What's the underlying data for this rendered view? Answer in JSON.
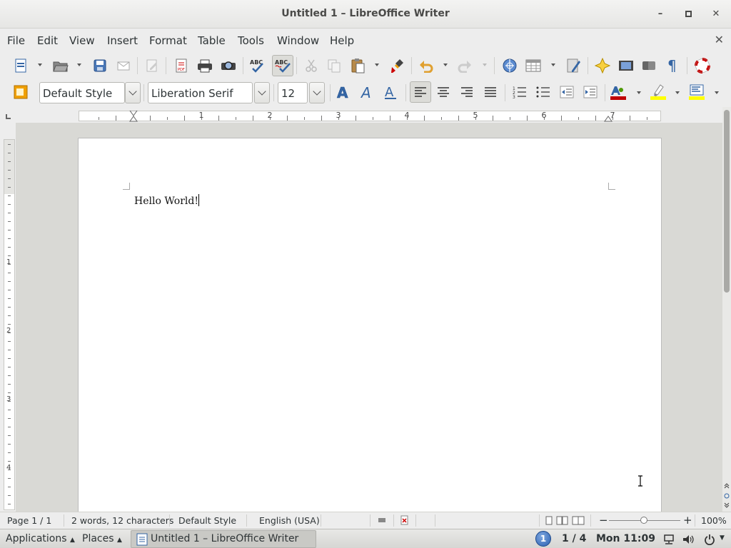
{
  "window": {
    "title": "Untitled 1 – LibreOffice Writer",
    "minimize": "–",
    "maximize": "□",
    "close": "✕"
  },
  "menu": {
    "items": [
      "File",
      "Edit",
      "View",
      "Insert",
      "Format",
      "Table",
      "Tools",
      "Window",
      "Help"
    ],
    "close": "✕"
  },
  "toolbar": {
    "paragraph_style": "Default Style",
    "font_name": "Liberation Serif",
    "font_size": "12",
    "colors": {
      "font_color": "#c00000",
      "highlight": "#ffff00",
      "background": "#ffff00"
    }
  },
  "ruler": {
    "labels": [
      "1",
      "2",
      "3",
      "4",
      "5",
      "6",
      "7"
    ],
    "vlabels": [
      "1",
      "2",
      "3",
      "4"
    ]
  },
  "document": {
    "text": "Hello World!"
  },
  "status": {
    "page": "Page 1 / 1",
    "words": "2 words, 12 characters",
    "style": "Default Style",
    "language": "English (USA)",
    "zoom": "100%"
  },
  "taskbar": {
    "applications": "Applications",
    "places": "Places",
    "window": "Untitled 1 – LibreOffice Writer",
    "workspace_badge": "1",
    "workspace": "1 / 4",
    "clock": "Mon 11:09"
  }
}
